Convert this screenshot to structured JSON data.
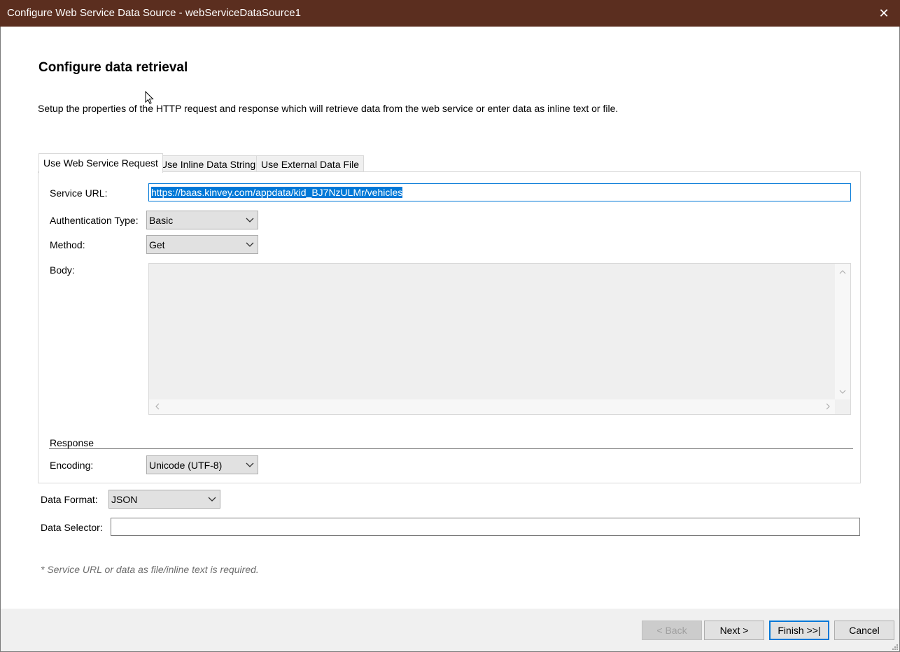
{
  "window": {
    "title": "Configure Web Service Data Source - webServiceDataSource1",
    "close_glyph": "✕"
  },
  "page": {
    "heading": "Configure data retrieval",
    "description": "Setup the properties of the HTTP request and response which will retrieve data from the web service or enter data as inline text or file."
  },
  "tabs": [
    {
      "label": "Use Web Service Request",
      "active": true
    },
    {
      "label": "Use Inline Data String",
      "active": false
    },
    {
      "label": "Use External Data File",
      "active": false
    }
  ],
  "request": {
    "service_url_label": "Service URL:",
    "service_url_value": "https://baas.kinvey.com/appdata/kid_BJ7NzULMr/vehicles",
    "auth_type_label": "Authentication Type:",
    "auth_type_value": "Basic",
    "method_label": "Method:",
    "method_value": "Get",
    "body_label": "Body:",
    "body_value": ""
  },
  "response": {
    "section_label": "Response",
    "encoding_label": "Encoding:",
    "encoding_value": "Unicode (UTF-8)"
  },
  "data_format": {
    "label": "Data Format:",
    "value": "JSON"
  },
  "data_selector": {
    "label": "Data Selector:",
    "value": ""
  },
  "note": "* Service URL or data as file/inline text is required.",
  "buttons": {
    "back": {
      "label": "< Back",
      "enabled": false
    },
    "next": {
      "label": "Next >",
      "enabled": true
    },
    "finish": {
      "label": "Finish >>|",
      "enabled": true
    },
    "cancel": {
      "label": "Cancel",
      "enabled": true
    }
  },
  "colors": {
    "titlebar": "#5b2e1f",
    "accent": "#0078d7",
    "footer": "#f0f0f0"
  },
  "icons": [
    "close-icon",
    "chevron-down-icon",
    "scroll-up-icon",
    "scroll-down-icon",
    "scroll-left-icon",
    "scroll-right-icon",
    "resize-grip-icon"
  ]
}
